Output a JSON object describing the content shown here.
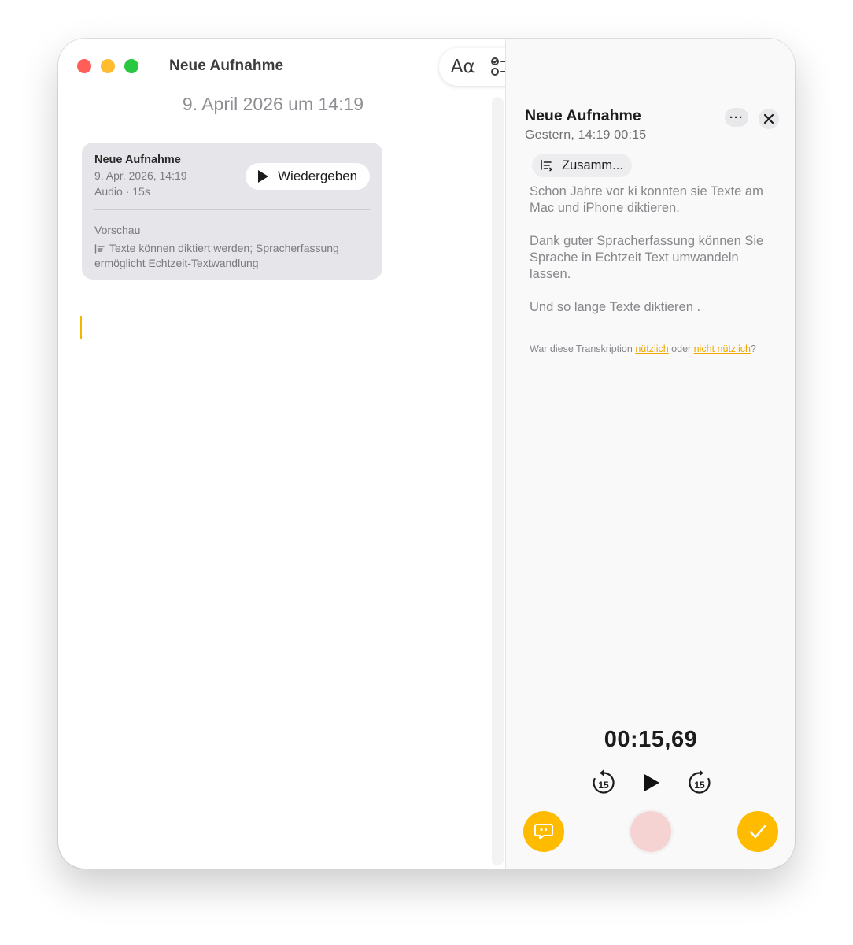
{
  "window": {
    "title": "Neue Aufnahme"
  },
  "toolbar": {
    "format_label": "Aα",
    "icons": [
      "text-format-icon",
      "checklist-icon",
      "table-icon",
      "paperclip-icon",
      "writing-tools-icon",
      "collaborate-icon",
      "share-icon",
      "more-icon"
    ]
  },
  "note": {
    "date_header": "9. April 2026 um 14:19"
  },
  "audio_card": {
    "title": "Neue Aufnahme",
    "date": "9. Apr. 2026, 14:19",
    "meta": "Audio · 15s",
    "play_label": "Wiedergeben",
    "preview_label": "Vorschau",
    "preview_text": "Texte können diktiert werden; Spracherfassung ermöglicht Echtzeit-Textwandlung"
  },
  "panel": {
    "title": "Neue Aufnahme",
    "subtitle": "Gestern, 14:19   00:15",
    "more_label": "···",
    "summary_label": "Zusamm...",
    "transcript": [
      "Schon Jahre vor ki konnten sie Texte am Mac und iPhone diktieren.",
      "Dank guter Spracherfassung können Sie Sprache in Echtzeit Text umwandeln lassen.",
      "Und so lange Texte diktieren ."
    ],
    "feedback": {
      "prefix": "War diese Transkription ",
      "useful": "nützlich",
      "middle": " oder ",
      "not_useful": "nicht nützlich",
      "suffix": "?"
    },
    "timer": "00:15,69",
    "skip_back_label": "15",
    "skip_fwd_label": "15"
  },
  "colors": {
    "accent": "#ffbb00",
    "link": "#f0a700",
    "record": "#f6d3d3",
    "card_bg": "#e6e6ea"
  }
}
